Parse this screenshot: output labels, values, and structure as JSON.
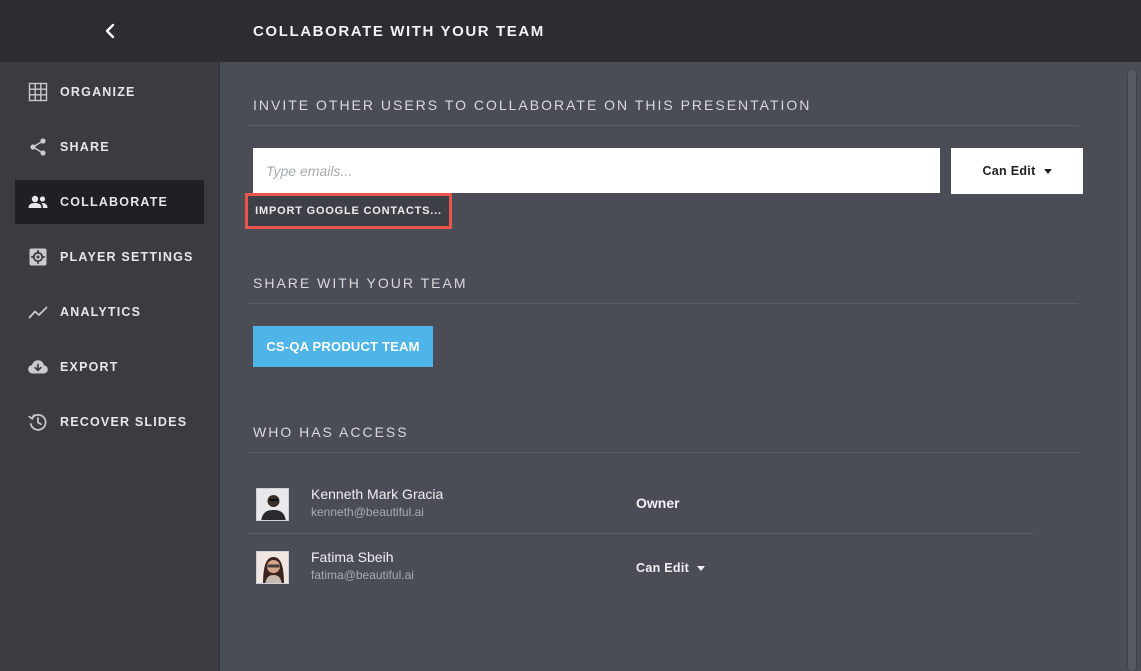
{
  "header": {
    "title": "COLLABORATE WITH YOUR TEAM"
  },
  "sidebar": {
    "items": [
      {
        "label": "ORGANIZE",
        "icon": "grid-icon"
      },
      {
        "label": "SHARE",
        "icon": "share-icon"
      },
      {
        "label": "COLLABORATE",
        "icon": "people-icon",
        "active": true
      },
      {
        "label": "PLAYER SETTINGS",
        "icon": "gear-icon"
      },
      {
        "label": "ANALYTICS",
        "icon": "chart-line-icon"
      },
      {
        "label": "EXPORT",
        "icon": "cloud-download-icon"
      },
      {
        "label": "RECOVER SLIDES",
        "icon": "history-icon"
      }
    ]
  },
  "invite": {
    "title": "INVITE OTHER USERS TO COLLABORATE ON THIS PRESENTATION",
    "email_placeholder": "Type emails...",
    "permission_value": "Can Edit",
    "import_label": "IMPORT GOOGLE CONTACTS..."
  },
  "team": {
    "title": "SHARE WITH YOUR TEAM",
    "button_label": "CS-QA PRODUCT TEAM"
  },
  "access": {
    "title": "WHO HAS ACCESS",
    "users": [
      {
        "name": "Kenneth Mark Gracia",
        "email": "kenneth@beautiful.ai",
        "role": "Owner"
      },
      {
        "name": "Fatima Sbeih",
        "email": "fatima@beautiful.ai",
        "role": "Can Edit"
      }
    ]
  },
  "colors": {
    "accent": "#4fb4e8",
    "highlight": "#e9554a",
    "sidebar": "#3a3c42",
    "main": "#4a4d55"
  }
}
